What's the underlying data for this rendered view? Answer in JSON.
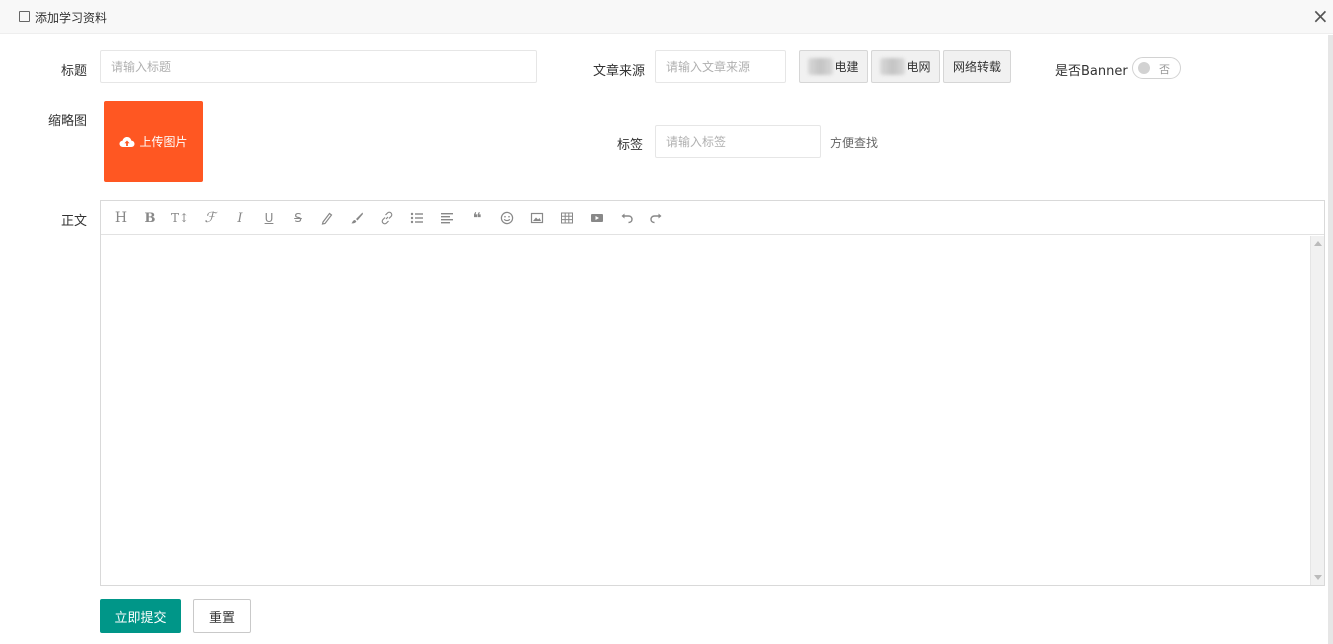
{
  "dialog": {
    "title": "添加学习资料",
    "close_icon": "close-icon",
    "close_glyph": "×"
  },
  "form": {
    "title_label": "标题",
    "title_placeholder": "请输入标题",
    "source_label": "文章来源",
    "source_placeholder": "请输入文章来源",
    "source_buttons": [
      {
        "label": "电建",
        "redacted": true
      },
      {
        "label": "电网",
        "redacted": true
      },
      {
        "label": "网络转载",
        "redacted": false
      }
    ],
    "banner_label": "是否Banner",
    "banner_switch_text": "否",
    "banner_value": false,
    "thumbnail_label": "缩略图",
    "upload_label": "上传图片",
    "upload_icon": "cloud-upload-icon",
    "tag_label": "标签",
    "tag_placeholder": "请输入标签",
    "tag_hint": "方便查找",
    "body_label": "正文"
  },
  "editor": {
    "toolbar": [
      "heading-icon",
      "bold-icon",
      "font-size-icon",
      "font-family-icon",
      "italic-icon",
      "underline-icon",
      "strikethrough-icon",
      "font-color-icon",
      "background-color-icon",
      "link-icon",
      "list-icon",
      "justify-icon",
      "quote-icon",
      "emoticon-icon",
      "image-icon",
      "table-icon",
      "video-icon",
      "undo-icon",
      "redo-icon"
    ],
    "content": ""
  },
  "actions": {
    "submit_label": "立即提交",
    "reset_label": "重置"
  },
  "colors": {
    "upload_button": "#ff5722",
    "submit_button": "#009688",
    "switch_off": "#d2d2d2"
  }
}
